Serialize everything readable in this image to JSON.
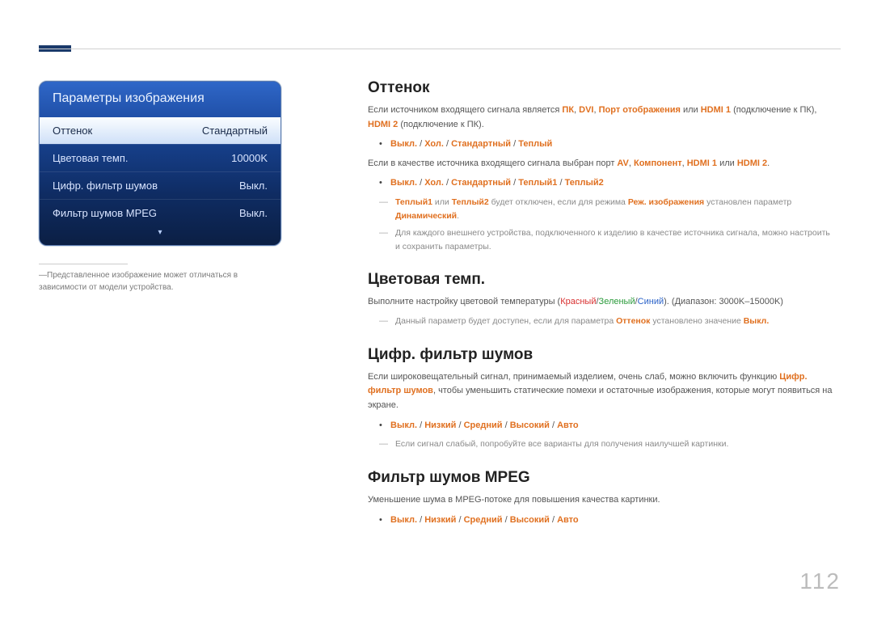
{
  "osd": {
    "title": "Параметры изображения",
    "rows": [
      {
        "label": "Оттенок",
        "value": "Стандартный"
      },
      {
        "label": "Цветовая темп.",
        "value": "10000K"
      },
      {
        "label": "Цифр. фильтр шумов",
        "value": "Выкл."
      },
      {
        "label": "Фильтр шумов MPEG",
        "value": "Выкл."
      }
    ],
    "caret": "▾"
  },
  "footnote": {
    "dash": "―",
    "text": "Представленное изображение может отличаться в зависимости от модели устройства."
  },
  "sections": {
    "tone": {
      "title": "Оттенок",
      "p1_a": "Если источником входящего сигнала является ",
      "p1_pc": "ПК",
      "p1_sep": ", ",
      "p1_dvi": "DVI",
      "p1_dp": "Порт отображения",
      "p1_or": " или ",
      "p1_hdmi1": "HDMI 1",
      "p1_b": " (подключение к ПК), ",
      "p1_hdmi2": "HDMI 2",
      "p1_c": " (подключение к ПК).",
      "opts1_off": "Выкл.",
      "opts1_cool": "Хол.",
      "opts1_std": "Стандартный",
      "opts1_warm": "Теплый",
      "slash": " / ",
      "p2_a": "Если в качестве источника входящего сигнала выбран порт ",
      "p2_av": "AV",
      "p2_comp": "Компонент",
      "p2_hdmi1": "HDMI 1",
      "p2_or": " или ",
      "p2_hdmi2": "HDMI 2",
      "p2_dot": ".",
      "opts2_off": "Выкл.",
      "opts2_cool": "Хол.",
      "opts2_std": "Стандартный",
      "opts2_w1": "Теплый1",
      "opts2_w2": "Теплый2",
      "note1_a": "Теплый1",
      "note1_or": " или ",
      "note1_b": "Теплый2",
      "note1_c": " будет отключен, если для режима ",
      "note1_mode": "Реж. изображения",
      "note1_d": " установлен параметр ",
      "note1_dyn": "Динамический",
      "note1_dot": ".",
      "note2": "Для каждого внешнего устройства, подключенного к изделию в качестве источника сигнала, можно настроить и сохранить параметры."
    },
    "temp": {
      "title": "Цветовая темп.",
      "p1_a": "Выполните настройку цветовой температуры (",
      "p1_r": "Красный",
      "p1_s1": "/",
      "p1_g": "Зеленый",
      "p1_s2": "/",
      "p1_b": "Синий",
      "p1_c": "). (Диапазон: 3000K–15000K)",
      "note_a": "Данный параметр будет доступен, если для параметра ",
      "note_tone": "Оттенок",
      "note_b": " установлено значение ",
      "note_off": "Выкл.",
      "note_dot": ""
    },
    "dnr": {
      "title": "Цифр. фильтр шумов",
      "p1": "Если широковещательный сигнал, принимаемый изделием, очень слаб, можно включить функцию ",
      "p1_b": "Цифр. фильтр шумов",
      "p1_c": ", чтобы уменьшить статические помехи и остаточные изображения, которые могут появиться на экране.",
      "o_off": "Выкл.",
      "o_low": "Низкий",
      "o_mid": "Средний",
      "o_high": "Высокий",
      "o_auto": "Авто",
      "slash": " / ",
      "note": "Если сигнал слабый, попробуйте все варианты для получения наилучшей картинки."
    },
    "mpeg": {
      "title": "Фильтр шумов MPEG",
      "p1": "Уменьшение шума в MPEG-потоке для повышения качества картинки.",
      "o_off": "Выкл.",
      "o_low": "Низкий",
      "o_mid": "Средний",
      "o_high": "Высокий",
      "o_auto": "Авто",
      "slash": " / "
    }
  },
  "page_number": "112"
}
